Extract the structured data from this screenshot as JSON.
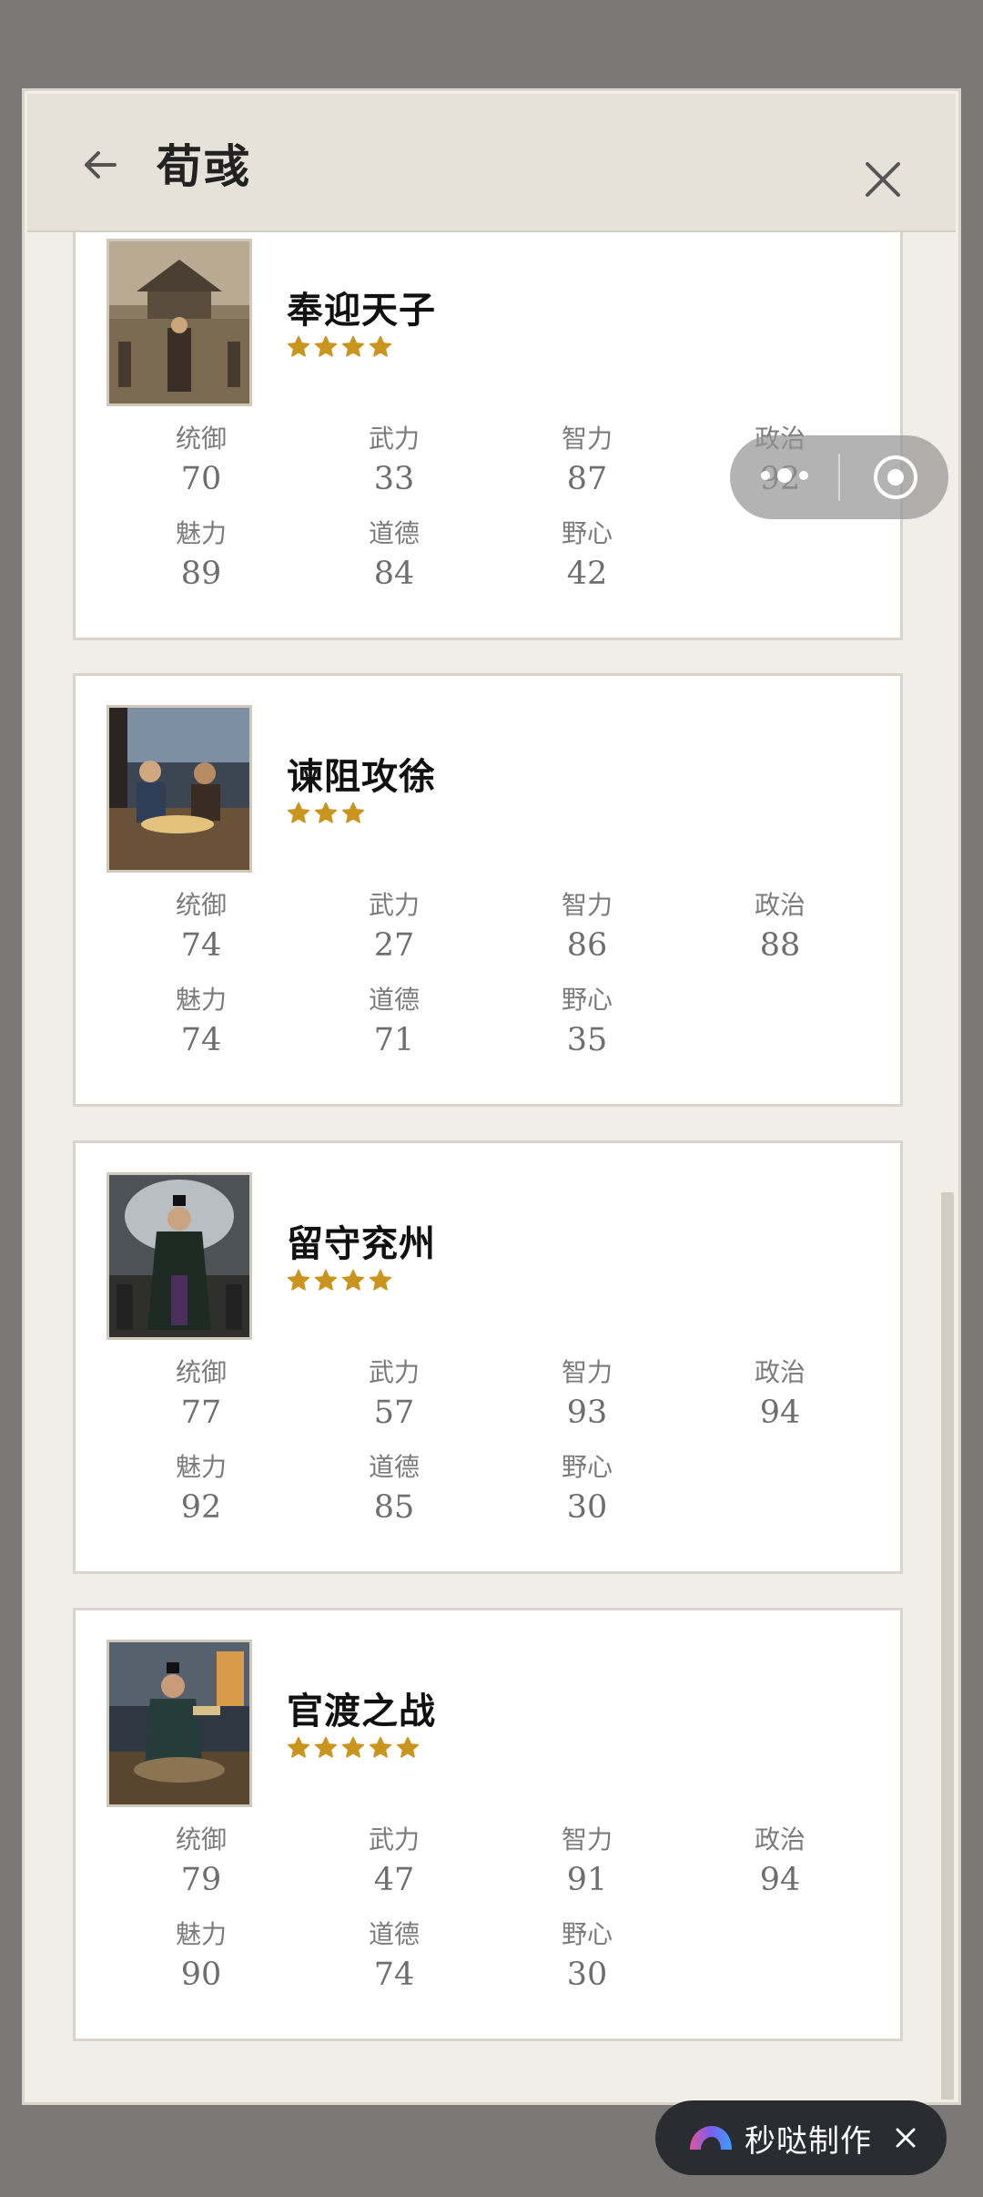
{
  "header": {
    "title": "荀彧"
  },
  "stat_labels": {
    "tongyu": "统御",
    "wuli": "武力",
    "zhili": "智力",
    "zhengzhi": "政治",
    "meili": "魅力",
    "daode": "道德",
    "yexin": "野心"
  },
  "cards": [
    {
      "title": "奉迎天子",
      "stars": 4,
      "stats": {
        "tongyu": "70",
        "wuli": "33",
        "zhili": "87",
        "zhengzhi": "92",
        "meili": "89",
        "daode": "84",
        "yexin": "42"
      }
    },
    {
      "title": "谏阻攻徐",
      "stars": 3,
      "stats": {
        "tongyu": "74",
        "wuli": "27",
        "zhili": "86",
        "zhengzhi": "88",
        "meili": "74",
        "daode": "71",
        "yexin": "35"
      }
    },
    {
      "title": "留守兖州",
      "stars": 4,
      "stats": {
        "tongyu": "77",
        "wuli": "57",
        "zhili": "93",
        "zhengzhi": "94",
        "meili": "92",
        "daode": "85",
        "yexin": "30"
      }
    },
    {
      "title": "官渡之战",
      "stars": 5,
      "stats": {
        "tongyu": "79",
        "wuli": "47",
        "zhili": "91",
        "zhengzhi": "94",
        "meili": "90",
        "daode": "74",
        "yexin": "30"
      }
    }
  ],
  "badge": {
    "label": "秒哒制作"
  },
  "colors": {
    "star": "#c9951e",
    "header_bg": "#e6e2da",
    "page_bg": "#f1eee7",
    "overlay": "#7a7977"
  },
  "icons": [
    "back-arrow-icon",
    "close-icon",
    "star-icon",
    "more-dots-icon",
    "target-icon",
    "miaoda-logo-icon"
  ]
}
